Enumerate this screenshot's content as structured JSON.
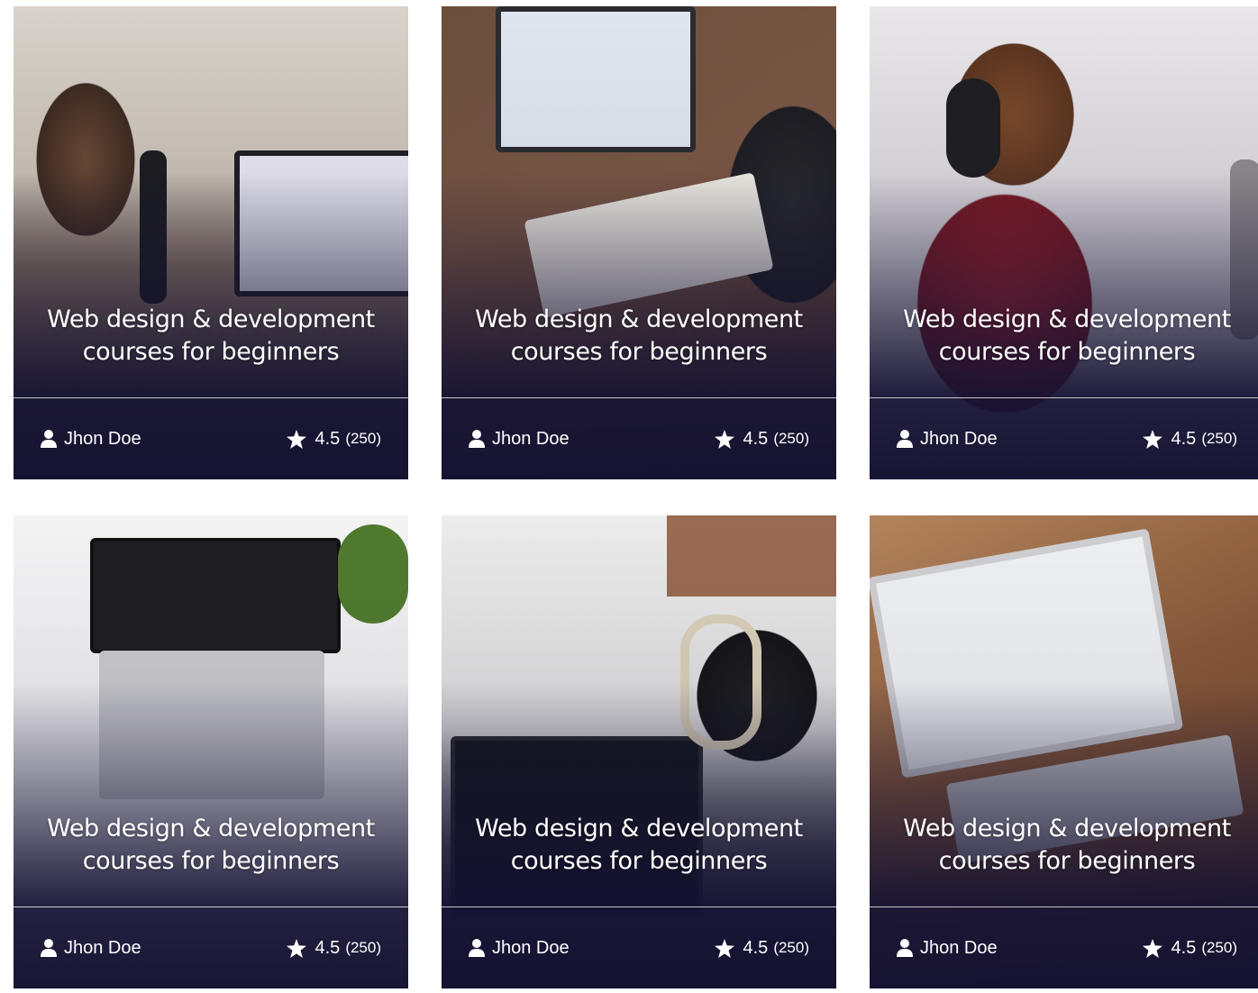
{
  "cards": [
    {
      "title_line1": "Web design & development",
      "title_line2": "courses for beginners",
      "author": "Jhon Doe",
      "rating": "4.5",
      "reviews": "(250)"
    },
    {
      "title_line1": "Web design & development",
      "title_line2": "courses for beginners",
      "author": "Jhon Doe",
      "rating": "4.5",
      "reviews": "(250)"
    },
    {
      "title_line1": "Web design & development",
      "title_line2": "courses for beginners",
      "author": "Jhon Doe",
      "rating": "4.5",
      "reviews": "(250)"
    },
    {
      "title_line1": "Web design & development",
      "title_line2": "courses for beginners",
      "author": "Jhon Doe",
      "rating": "4.5",
      "reviews": "(250)"
    },
    {
      "title_line1": "Web design & development",
      "title_line2": "courses for beginners",
      "author": "Jhon Doe",
      "rating": "4.5",
      "reviews": "(250)"
    },
    {
      "title_line1": "Web design & development",
      "title_line2": "courses for beginners",
      "author": "Jhon Doe",
      "rating": "4.5",
      "reviews": "(250)"
    }
  ],
  "icons": {
    "author": "user-icon",
    "rating": "star-icon"
  },
  "colors": {
    "overlay": "#141232",
    "text": "#ffffff"
  }
}
